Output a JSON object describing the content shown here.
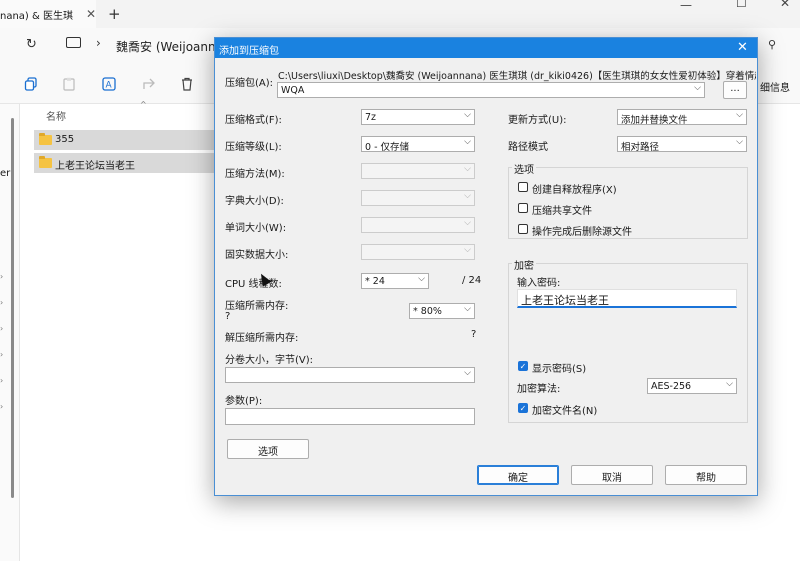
{
  "explorer": {
    "tab_title": "nana) & 医生琪",
    "breadcrumb": "魏喬安 (Weijoannan",
    "toolbar_detail": "细信息",
    "sidebar_text": "er",
    "column_name": "名称",
    "files": [
      {
        "name": "355"
      },
      {
        "name": "上老王论坛当老王"
      }
    ]
  },
  "dialog": {
    "title": "添加到压缩包",
    "archive_label": "压缩包(A):",
    "archive_path": "C:\\Users\\liuxi\\Desktop\\魏喬安 (Weijoannana) 医生琪琪 (dr_kiki0426)【医生琪琪的女女性爱初体验】穿着情趣睡衣",
    "archive_name": "WQA",
    "browse_label": "...",
    "format_label": "压缩格式(F):",
    "format_value": "7z",
    "level_label": "压缩等级(L):",
    "level_value": "0 - 仅存储",
    "method_label": "压缩方法(M):",
    "dict_label": "字典大小(D):",
    "word_label": "单词大小(W):",
    "solid_label": "固实数据大小:",
    "cpu_label": "CPU 线程数:",
    "cpu_value": "* 24",
    "cpu_total": "/ 24",
    "mem_comp_label": "压缩所需内存:",
    "mem_comp_q": "?",
    "mem_comp_value": "* 80%",
    "mem_decomp_label": "解压缩所需内存:",
    "mem_decomp_q": "?",
    "volume_label": "分卷大小，字节(V):",
    "params_label": "参数(P):",
    "options_btn": "选项",
    "update_label": "更新方式(U):",
    "update_value": "添加并替换文件",
    "path_mode_label": "路径模式",
    "path_mode_value": "相对路径",
    "options_group": "选项",
    "opt_sfx": "创建自释放程序(X)",
    "opt_shared": "压缩共享文件",
    "opt_delete": "操作完成后删除源文件",
    "encrypt_group": "加密",
    "password_label": "输入密码:",
    "password_value": "上老王论坛当老王",
    "show_password": "显示密码(S)",
    "enc_method_label": "加密算法:",
    "enc_method_value": "AES-256",
    "enc_filenames": "加密文件名(N)",
    "ok_btn": "确定",
    "cancel_btn": "取消",
    "help_btn": "帮助"
  }
}
